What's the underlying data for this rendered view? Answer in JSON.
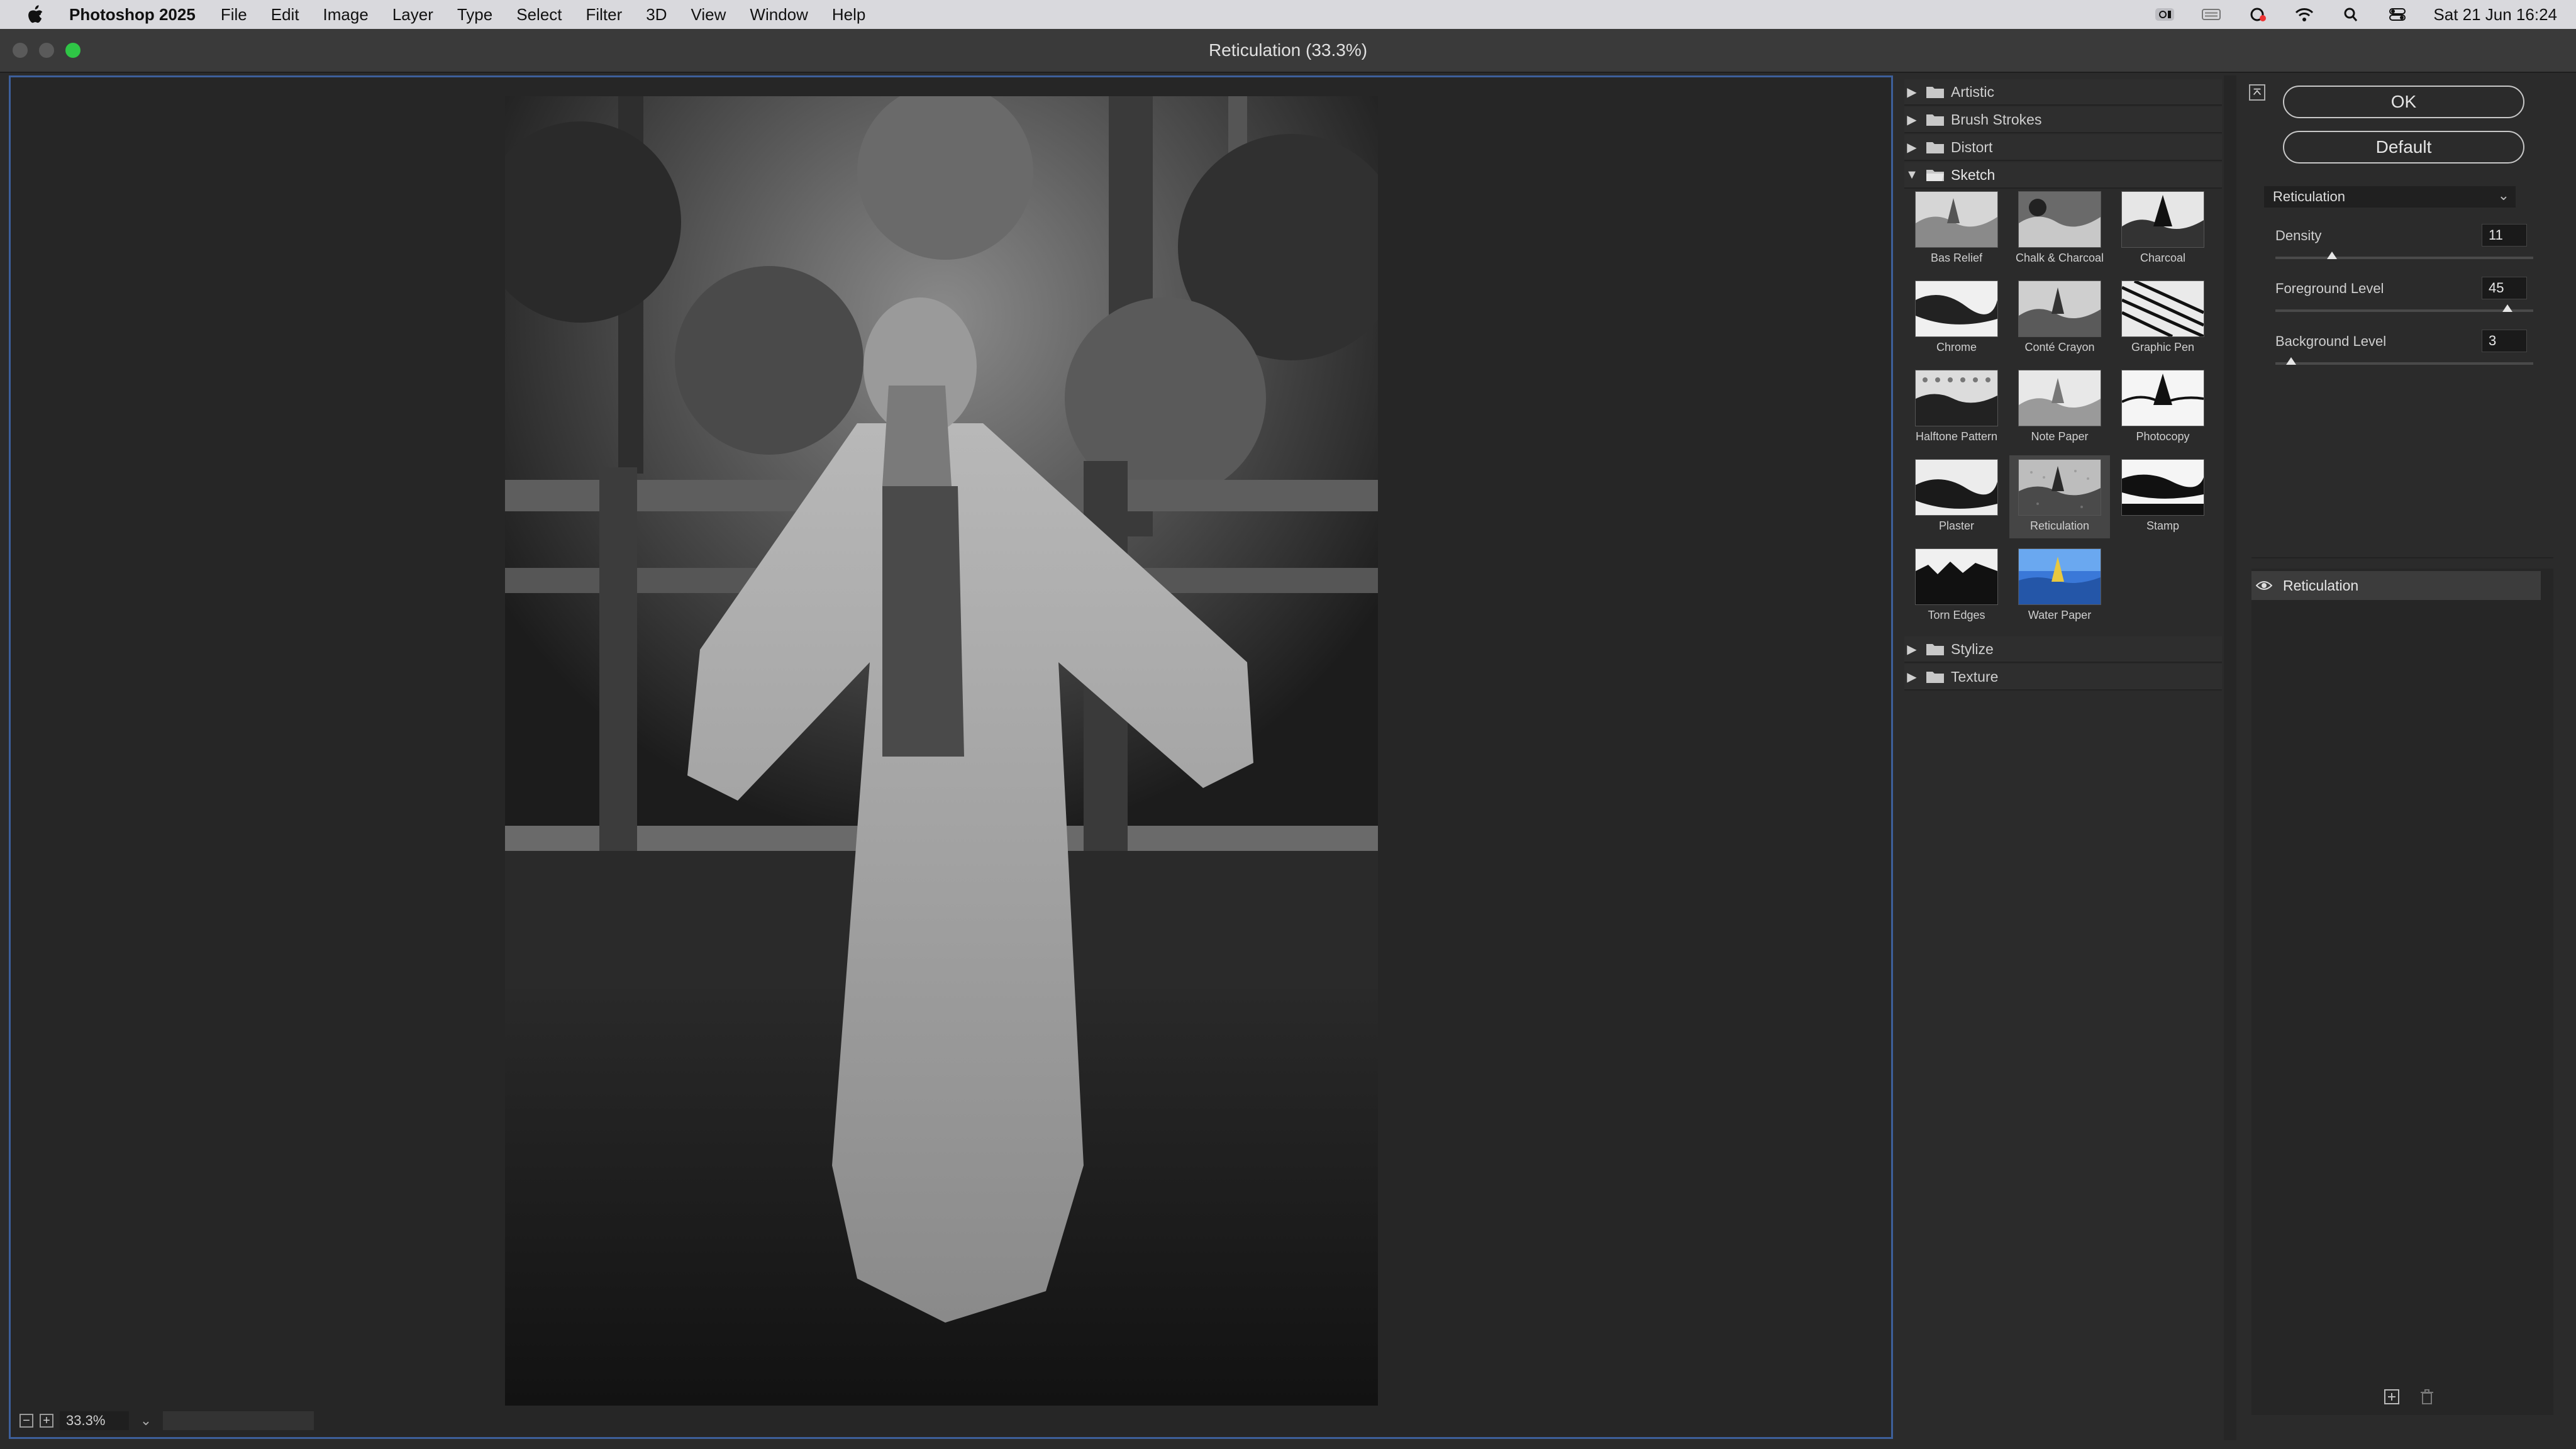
{
  "menubar": {
    "app_name": "Photoshop 2025",
    "menus": [
      "File",
      "Edit",
      "Image",
      "Layer",
      "Type",
      "Select",
      "Filter",
      "3D",
      "View",
      "Window",
      "Help"
    ],
    "datetime": "Sat 21 Jun  16:24",
    "status_icons": [
      "creative-cloud-icon",
      "keyboard-icon",
      "sync-icon",
      "wifi-icon",
      "search-icon",
      "control-center-icon"
    ]
  },
  "window": {
    "title": "Reticulation (33.3%)"
  },
  "preview": {
    "zoom": "33.3%"
  },
  "gallery": {
    "folders_top": [
      "Artistic",
      "Brush Strokes",
      "Distort"
    ],
    "open_folder": "Sketch",
    "filters": [
      "Bas Relief",
      "Chalk & Charcoal",
      "Charcoal",
      "Chrome",
      "Conté Crayon",
      "Graphic Pen",
      "Halftone Pattern",
      "Note Paper",
      "Photocopy",
      "Plaster",
      "Reticulation",
      "Stamp",
      "Torn Edges",
      "Water Paper"
    ],
    "selected_filter": "Reticulation",
    "folders_bottom": [
      "Stylize",
      "Texture"
    ]
  },
  "settings": {
    "ok_label": "OK",
    "default_label": "Default",
    "filter_name": "Reticulation",
    "params": [
      {
        "label": "Density",
        "value": "11",
        "fraction": 0.22
      },
      {
        "label": "Foreground Level",
        "value": "45",
        "fraction": 0.9
      },
      {
        "label": "Background Level",
        "value": "3",
        "fraction": 0.06
      }
    ],
    "layer_name": "Reticulation"
  },
  "colors": {
    "accent_border": "#3d5f9a",
    "traffic_green": "#2fc546",
    "panel_bg": "#2b2b2b"
  }
}
